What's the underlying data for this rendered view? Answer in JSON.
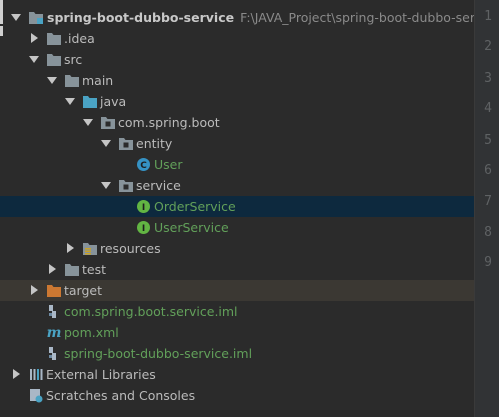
{
  "project_tree": {
    "root": {
      "name": "spring-boot-dubbo-service",
      "path": "F:\\JAVA_Project\\spring-boot-dubbo-service"
    },
    "idea": ".idea",
    "src": "src",
    "main": "main",
    "java": "java",
    "pkg": "com.spring.boot",
    "entity": "entity",
    "user": "User",
    "service": "service",
    "order_service": "OrderService",
    "user_service": "UserService",
    "resources": "resources",
    "test": "test",
    "target": "target",
    "iml1": "com.spring.boot.service.iml",
    "pom": "pom.xml",
    "iml2": "spring-boot-dubbo-service.iml",
    "ext_libs": "External Libraries",
    "scratches": "Scratches and Consoles"
  },
  "gutter": {
    "line_numbers": [
      "1",
      "2",
      "3",
      "4",
      "5",
      "6",
      "7",
      "8",
      "9"
    ]
  },
  "colors": {
    "background": "#2b2b2b",
    "selected_row": "#0d293e",
    "excluded_row": "#3b3833",
    "folder": "#87939a",
    "source_folder": "#4aa3c4",
    "excluded_folder": "#cc7832",
    "green_text": "#62a05a"
  },
  "icons": {
    "folder": "folder-icon",
    "package": "package-icon",
    "class": "class-icon",
    "interface": "interface-icon",
    "module": "module-icon",
    "maven": "maven-icon",
    "library": "library-icon",
    "scratch": "scratch-icon"
  }
}
